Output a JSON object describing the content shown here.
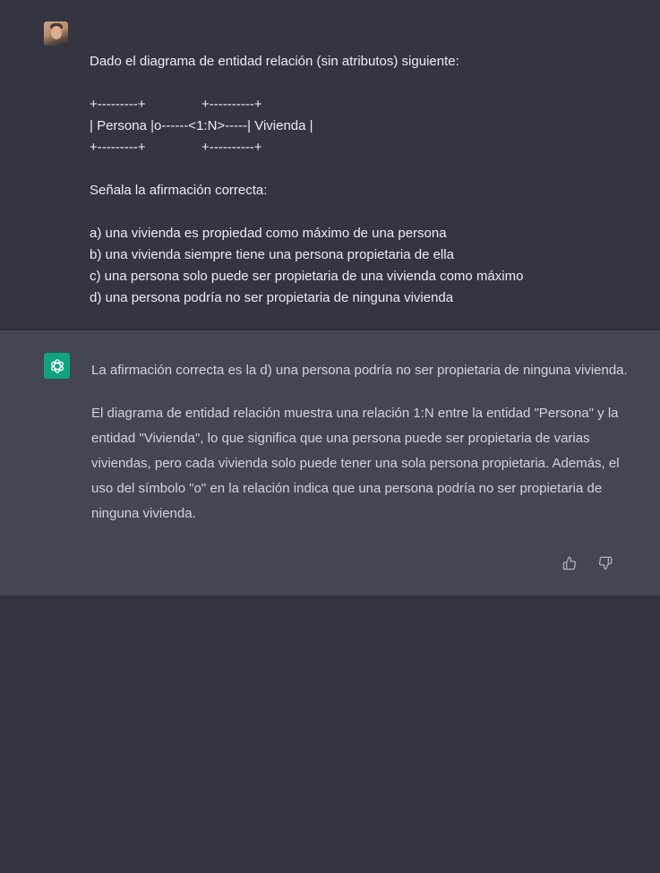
{
  "user_message": {
    "lines": [
      "Dado el diagrama de entidad relación (sin atributos) siguiente:",
      "",
      "+---------+               +----------+",
      "| Persona |o------<1:N>-----| Vivienda |",
      "+---------+               +----------+",
      "",
      "Señala la afirmación correcta:",
      "",
      "a) una vivienda es propiedad como máximo de una persona",
      "b) una vivienda siempre tiene una persona propietaria de ella",
      "c) una persona solo puede ser propietaria de una vivienda como máximo",
      "d) una persona podría no ser propietaria de ninguna vivienda"
    ]
  },
  "assistant_message": {
    "paragraphs": [
      "La afirmación correcta es la d) una persona podría no ser propietaria de ninguna vivienda.",
      "El diagrama de entidad relación muestra una relación 1:N entre la entidad \"Persona\" y la entidad \"Vivienda\", lo que significa que una persona puede ser propietaria de varias viviendas, pero cada vivienda solo puede tener una sola persona propietaria. Además, el uso del símbolo \"o\" en la relación indica que una persona podría no ser propietaria de ninguna vivienda."
    ]
  },
  "colors": {
    "user_bg": "#343541",
    "assistant_bg": "#444654",
    "accent": "#10a37f"
  }
}
